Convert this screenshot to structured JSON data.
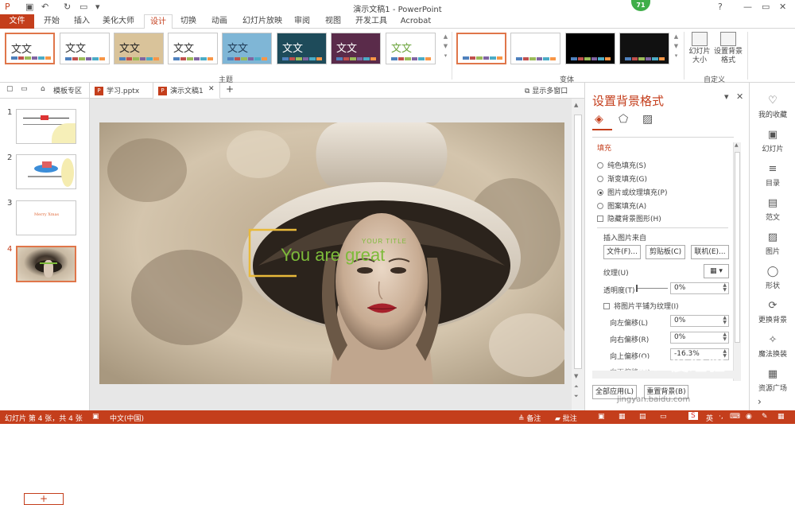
{
  "window": {
    "title": "演示文稿1 - PowerPoint",
    "help": "?",
    "min": "—",
    "restore": "▭",
    "close": "✕",
    "badge": "71"
  },
  "ribbon_tabs": [
    "文件",
    "开始",
    "插入",
    "美化大师",
    "设计",
    "切换",
    "动画",
    "幻灯片放映",
    "审阅",
    "视图",
    "开发工具",
    "Acrobat"
  ],
  "themes": {
    "items": [
      {
        "text": "文文",
        "bg": "#ffffff",
        "color": "#333333",
        "selected": true
      },
      {
        "text": "文文",
        "bg": "#ffffff",
        "color": "#333333"
      },
      {
        "text": "文文",
        "bg": "#d9c39a",
        "color": "#222222"
      },
      {
        "text": "文文",
        "bg": "#ffffff",
        "color": "#333333"
      },
      {
        "text": "文文",
        "bg": "#7fb6d6",
        "color": "#1f3a55"
      },
      {
        "text": "文文",
        "bg": "#1e4b5a",
        "color": "#ffffff"
      },
      {
        "text": "文文",
        "bg": "#5a2b4a",
        "color": "#ffffff"
      },
      {
        "text": "文文",
        "bg": "#ffffff",
        "color": "#6aa33a"
      }
    ],
    "group_label": "主题"
  },
  "variants": {
    "items": [
      {
        "bg": "#ffffff"
      },
      {
        "bg": "#ffffff"
      },
      {
        "bg": "#000000"
      },
      {
        "bg": "#111111"
      }
    ],
    "group_label": "变体"
  },
  "customize": {
    "slide_size": "幻灯片大小",
    "format_bg": "设置背景格式",
    "group_label": "自定义"
  },
  "doc_tabs": {
    "templates": "模板专区",
    "tab1": "学习.pptx",
    "tab2": "演示文稿1",
    "add": "+",
    "multi_window": "显示多窗口"
  },
  "slides": [
    {
      "num": "1"
    },
    {
      "num": "2"
    },
    {
      "num": "3",
      "text": "Merry Xmas"
    },
    {
      "num": "4"
    }
  ],
  "add_slide": "+",
  "slide": {
    "your_title": "YOUR TITLE",
    "headline": "You are great"
  },
  "format_pane": {
    "title": "设置背景格式",
    "section": "填充",
    "options": [
      {
        "label": "纯色填充(S)",
        "on": false
      },
      {
        "label": "渐变填充(G)",
        "on": false
      },
      {
        "label": "图片或纹理填充(P)",
        "on": true
      },
      {
        "label": "图案填充(A)",
        "on": false
      }
    ],
    "hide_bg": "隐藏背景图形(H)",
    "insert_from": "插入图片来自",
    "btn_file": "文件(F)...",
    "btn_clipboard": "剪贴板(C)",
    "btn_online": "联机(E)...",
    "texture": "纹理(U)",
    "transparency": "透明度(T)",
    "transparency_val": "0%",
    "tile": "将图片平铺为纹理(I)",
    "offset_left": "向左偏移(L)",
    "offset_left_val": "0%",
    "offset_right": "向右偏移(R)",
    "offset_right_val": "0%",
    "offset_top": "向上偏移(O)",
    "offset_top_val": "-16.3%",
    "offset_bottom": "向下偏移(M)",
    "apply_all": "全部应用(L)",
    "reset": "重置背景(B)"
  },
  "right_sidebar": [
    {
      "icon": "♡",
      "label": "我的收藏"
    },
    {
      "icon": "▣",
      "label": "幻灯片"
    },
    {
      "icon": "≡",
      "label": "目录"
    },
    {
      "icon": "▤",
      "label": "范文"
    },
    {
      "icon": "▨",
      "label": "图片"
    },
    {
      "icon": "◯",
      "label": "形状"
    },
    {
      "icon": "⟳",
      "label": "更换背景"
    },
    {
      "icon": "✧",
      "label": "魔法换装"
    },
    {
      "icon": "▦",
      "label": "资源广场"
    }
  ],
  "status": {
    "slide_info": "幻灯片 第 4 张，共 4 张",
    "language": "中文(中国)",
    "notes": "备注",
    "comments": "批注"
  },
  "watermark": {
    "text": "Bai度经验",
    "url": "jingyan.baidu.com"
  },
  "colors": {
    "accent": "#c43e1c",
    "headline": "#7dbb3a",
    "frame": "#e8b93a"
  }
}
